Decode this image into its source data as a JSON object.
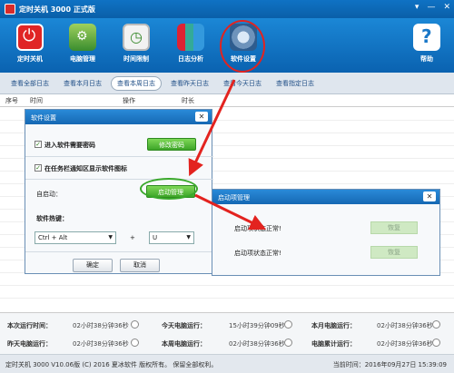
{
  "window": {
    "title": "定时关机 3000 正式版",
    "controls": [
      "▾",
      "—",
      "✕"
    ]
  },
  "toolbar": {
    "items": [
      {
        "label": "定时关机",
        "icon": "power-icon"
      },
      {
        "label": "电脑管理",
        "icon": "computer-management-icon"
      },
      {
        "label": "时间限制",
        "icon": "clock-icon"
      },
      {
        "label": "日志分析",
        "icon": "chart-icon"
      },
      {
        "label": "软件设置",
        "icon": "settings-gear-icon"
      },
      {
        "label": "帮助",
        "icon": "help-icon"
      }
    ]
  },
  "tabs": [
    "查看全部日志",
    "查看本月日志",
    "查看本周日志",
    "查看昨天日志",
    "查看今天日志",
    "查看指定日志"
  ],
  "table": {
    "headers": [
      "序号",
      "时间",
      "操作",
      "时长"
    ]
  },
  "stats": {
    "this_run_label": "本次运行时间：",
    "this_run_value": "02小时38分钟36秒",
    "today_label": "今天电脑运行：",
    "today_value": "15小时39分钟09秒",
    "month_label": "本月电脑运行：",
    "month_value": "02小时38分钟36秒",
    "yesterday_label": "昨天电脑运行：",
    "yesterday_value": "02小时38分钟36秒",
    "week_label": "本周电脑运行：",
    "week_value": "02小时38分钟36秒",
    "total_label": "电脑累计运行：",
    "total_value": "02小时38分钟36秒"
  },
  "footer": {
    "copyright": "定时关机 3000 V10.06版 (C) 2016  夏冰软件 版权所有。 保留全部权利。",
    "time": "当前时间：2016年09月27日 15:39:09"
  },
  "settings_dialog": {
    "title": "软件设置",
    "close": "✕",
    "check_password": "进入软件需要密码",
    "change_password": "修改密码",
    "check_tray": "在任务栏通知区显示软件图标",
    "autostart_label": "自启动：",
    "autostart_button": "启动管理",
    "hotkey_label": "软件热键：",
    "hotkey_modifier": "Ctrl + Alt",
    "hotkey_plus": "+",
    "hotkey_key": "U",
    "ok": "确定",
    "cancel": "取消"
  },
  "startup_dialog": {
    "title": "启动项管理",
    "close": "✕",
    "row1_text": "启动项状态正常!",
    "row1_button": "恢复",
    "row2_text": "启动项状态正常!",
    "row2_button": "恢复"
  }
}
